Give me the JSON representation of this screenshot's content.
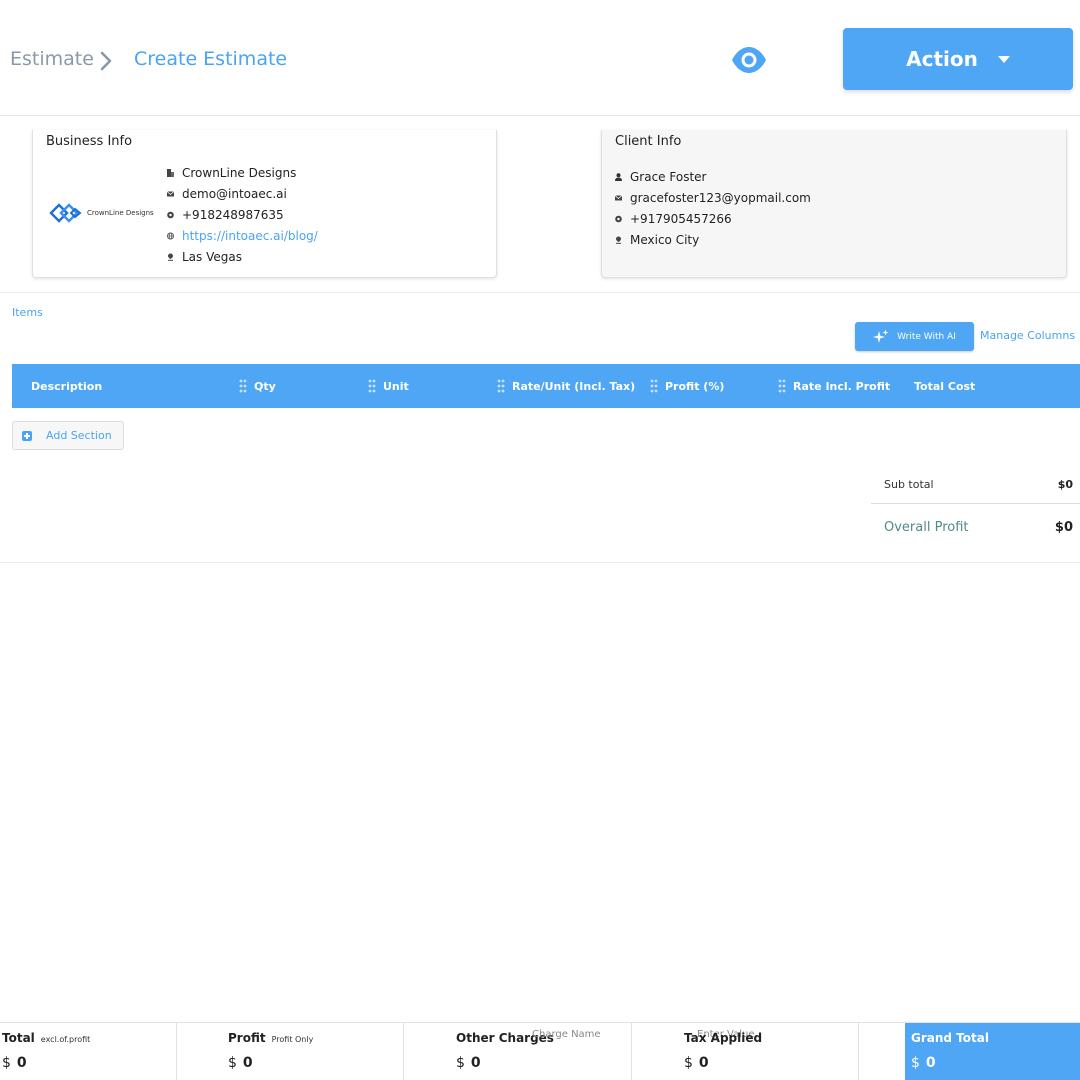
{
  "breadcrumb": {
    "root": "Estimate",
    "current": "Create Estimate"
  },
  "header": {
    "action_label": "Action",
    "preview_icon": "eye-icon"
  },
  "business_info": {
    "title": "Business Info",
    "logo_text": "CrownLine Designs",
    "company": "CrownLine Designs",
    "email": "demo@intoaec.ai",
    "phone": "+918248987635",
    "website": "https://intoaec.ai/blog/",
    "location": "Las Vegas"
  },
  "client_info": {
    "title": "Client Info",
    "name": "Grace Foster",
    "email": "gracefoster123@yopmail.com",
    "phone": "+917905457266",
    "location": "Mexico City"
  },
  "items": {
    "label": "Items",
    "write_ai_label": "Write With AI",
    "manage_columns_label": "Manage Columns",
    "columns": [
      "Description",
      "Qty",
      "Unit",
      "Rate/Unit (Incl. Tax)",
      "Profit (%)",
      "Rate Incl. Profit",
      "Total Cost"
    ],
    "add_section_label": "Add Section"
  },
  "summary": {
    "subtotal_label": "Sub total",
    "subtotal_value": "$0",
    "overall_profit_label": "Overall Profit",
    "overall_profit_value": "$0"
  },
  "footer": {
    "total_label": "Total",
    "total_sub": "excl.of.profit",
    "total_value": "0",
    "profit_label": "Profit",
    "profit_sub": "Profit Only",
    "profit_value": "0",
    "other_charges_label": "Other Charges",
    "charge_name_placeholder": "Charge Name",
    "other_charges_value": "0",
    "tax_label": "Tax Applied",
    "enter_value_placeholder": "Enter Value",
    "tax_value": "0",
    "grand_total_label": "Grand Total",
    "grand_total_value": "0",
    "currency": "$"
  },
  "colors": {
    "accent": "#4ea6f5",
    "link": "#4ba3f4",
    "muted": "#8a98a8"
  }
}
